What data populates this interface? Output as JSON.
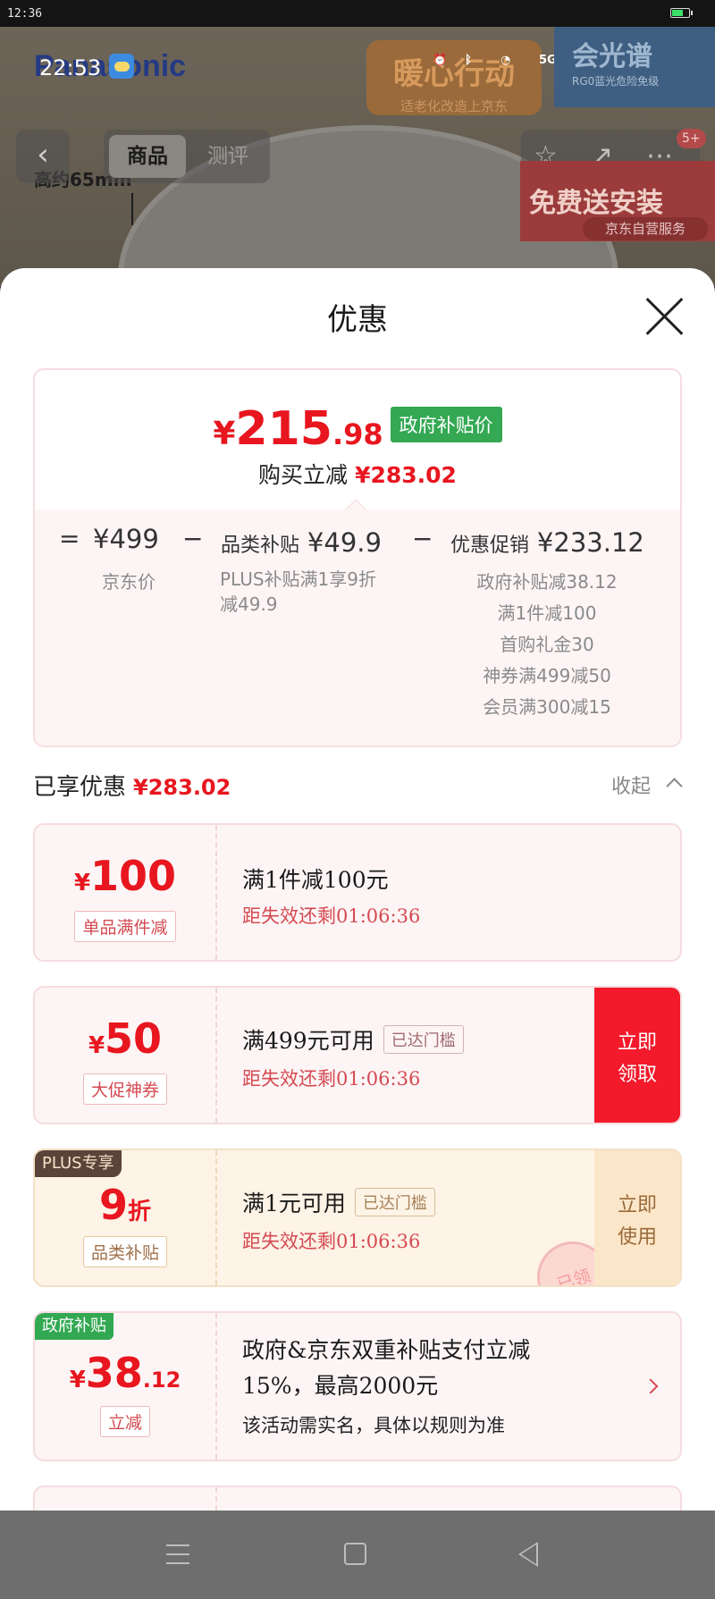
{
  "status_bar": {
    "time": "12:36"
  },
  "product_page": {
    "brand": "Panasonic",
    "overlay_clock": "22:53",
    "network_labels": [
      "5G",
      "5G"
    ],
    "promo_left_title": "暖心行动",
    "promo_left_sub": "适老化改造上京东",
    "promo_right_title": "会光谱",
    "promo_right_sub": "RG0蓝光危险免级",
    "height_label": "高约65mm",
    "back_label": "‹",
    "tabs": [
      "商品",
      "测评"
    ],
    "cart_badge": "5+",
    "install_title": "免费送安装",
    "install_sub": "京东自营服务"
  },
  "sheet": {
    "title": "优惠",
    "summary": {
      "price_symbol": "¥",
      "price_int": "215",
      "price_dec": ".98",
      "price_tag": "政府补贴价",
      "buy_label": "购买立减",
      "buy_amount": "¥283.02",
      "eq": "=",
      "minus1": "−",
      "minus2": "−",
      "jd_price": "¥499",
      "jd_price_label": "京东价",
      "category_label": "品类补贴",
      "category_amount": "¥49.9",
      "category_details": [
        "PLUS补贴满1享9折",
        "减49.9"
      ],
      "promo_label": "优惠促销",
      "promo_amount": "¥233.12",
      "promo_details": [
        "政府补贴减38.12",
        "满1件减100",
        "首购礼金30",
        "神券满499减50",
        "会员满300减15"
      ]
    },
    "enjoyed_label": "已享优惠",
    "enjoyed_amount": "¥283.02",
    "collapse_label": "收起",
    "coupons": [
      {
        "symbol": "¥",
        "amount": "100",
        "tag": "单品满件减",
        "title": "满1件减100元",
        "expire": "距失效还剩01:06:36"
      },
      {
        "symbol": "¥",
        "amount": "50",
        "tag": "大促神券",
        "title": "满499元可用",
        "reached": "已达门槛",
        "expire": "距失效还剩01:06:36",
        "action": [
          "立即",
          "领取"
        ]
      },
      {
        "ribbon": "PLUS专享",
        "amount": "9",
        "unit": "折",
        "tag": "品类补贴",
        "title": "满1元可用",
        "reached": "已达门槛",
        "expire": "距失效还剩01:06:36",
        "action": [
          "立即",
          "使用"
        ],
        "stamp": "已领"
      },
      {
        "ribbon": "政府补贴",
        "symbol": "¥",
        "amount": "38",
        "decimal": ".12",
        "tag": "立减",
        "title_lines": [
          "政府&京东双重补贴支付立减",
          "15%，最高2000元"
        ],
        "note": "该活动需实名，具体以规则为准"
      }
    ]
  }
}
